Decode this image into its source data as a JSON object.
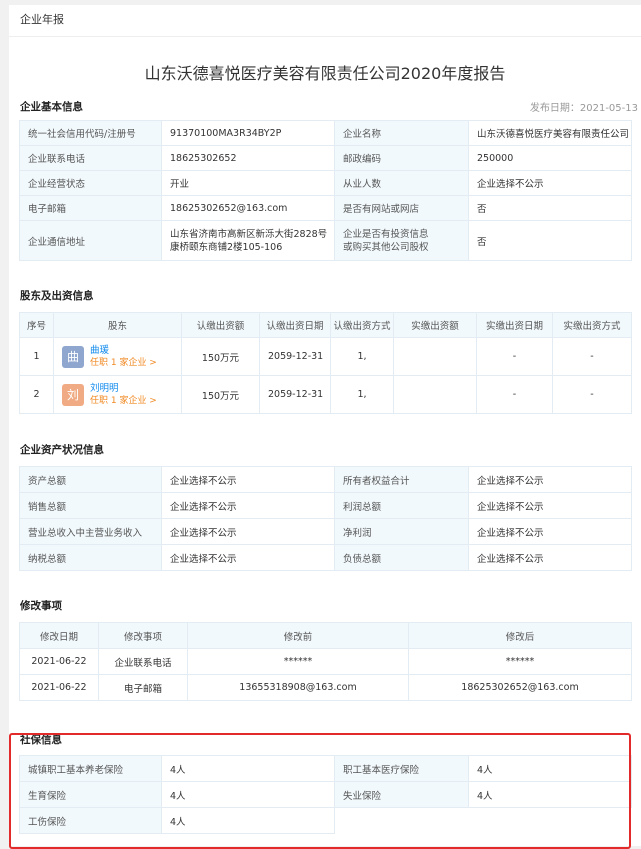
{
  "crumb": "企业年报",
  "title": "山东沃德喜悦医疗美容有限责任公司2020年度报告",
  "basic": {
    "heading": "企业基本信息",
    "publish": "发布日期：2021-05-13",
    "rows": [
      [
        "统一社会信用代码/注册号",
        "91370100MA3R34BY2P",
        "企业名称",
        "山东沃德喜悦医疗美容有限责任公司"
      ],
      [
        "企业联系电话",
        "18625302652",
        "邮政编码",
        "250000"
      ],
      [
        "企业经营状态",
        "开业",
        "从业人数",
        "企业选择不公示"
      ],
      [
        "电子邮箱",
        "18625302652@163.com",
        "是否有网站或网店",
        "否"
      ]
    ],
    "addr_label": "企业通信地址",
    "addr_line1": "山东省济南市高新区新泺大街2828号",
    "addr_line2": "康桥颐东商铺2楼105-106",
    "invest_label_1": "企业是否有投资信息",
    "invest_label_2": "或购买其他公司股权",
    "invest_value": "否"
  },
  "shareholders": {
    "heading": "股东及出资信息",
    "headers": [
      "序号",
      "股东",
      "认缴出资额",
      "认缴出资日期",
      "认缴出资方式",
      "实缴出资额",
      "实缴出资日期",
      "实缴出资方式"
    ],
    "rows": [
      {
        "no": "1",
        "avatar": "曲",
        "avatar_color": "#8fa6cf",
        "name": "曲瑗",
        "sub": "任职 1 家企业 >",
        "amount": "150万元",
        "date": "2059-12-31",
        "method": "1,",
        "paid": "",
        "paid_date": "-",
        "paid_method": "-"
      },
      {
        "no": "2",
        "avatar": "刘",
        "avatar_color": "#f0ab84",
        "name": "刘明明",
        "sub": "任职 1 家企业 >",
        "amount": "150万元",
        "date": "2059-12-31",
        "method": "1,",
        "paid": "",
        "paid_date": "-",
        "paid_method": "-"
      }
    ]
  },
  "assets": {
    "heading": "企业资产状况信息",
    "rows": [
      [
        "资产总额",
        "企业选择不公示",
        "所有者权益合计",
        "企业选择不公示"
      ],
      [
        "销售总额",
        "企业选择不公示",
        "利润总额",
        "企业选择不公示"
      ],
      [
        "营业总收入中主营业务收入",
        "企业选择不公示",
        "净利润",
        "企业选择不公示"
      ],
      [
        "纳税总额",
        "企业选择不公示",
        "负债总额",
        "企业选择不公示"
      ]
    ]
  },
  "changes": {
    "heading": "修改事项",
    "headers": [
      "修改日期",
      "修改事项",
      "修改前",
      "修改后"
    ],
    "rows": [
      [
        "2021-06-22",
        "企业联系电话",
        "******",
        "******"
      ],
      [
        "2021-06-22",
        "电子邮箱",
        "13655318908@163.com",
        "18625302652@163.com"
      ]
    ]
  },
  "social": {
    "heading": "社保信息",
    "rows": [
      [
        "城镇职工基本养老保险",
        "4人",
        "职工基本医疗保险",
        "4人"
      ],
      [
        "生育保险",
        "4人",
        "失业保险",
        "4人"
      ],
      [
        "工伤保险",
        "4人",
        "",
        ""
      ]
    ]
  },
  "colors": {
    "highlight": "#e22a2a",
    "label_bg": "#f2f9fc",
    "link": "#128bed",
    "sub": "#f08a24"
  }
}
